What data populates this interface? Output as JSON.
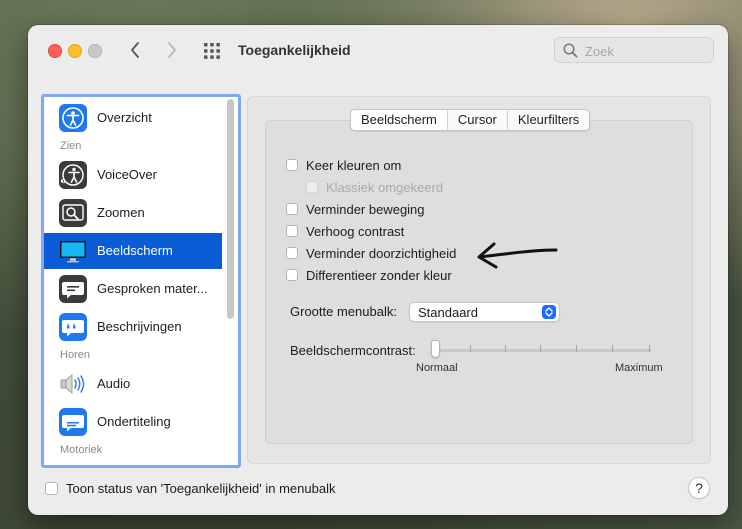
{
  "window": {
    "title": "Toegankelijkheid"
  },
  "search": {
    "placeholder": "Zoek"
  },
  "sidebar": {
    "items": [
      {
        "label": "Overzicht",
        "icon": "accessibility-icon"
      },
      {
        "section": "Zien"
      },
      {
        "label": "VoiceOver",
        "icon": "voiceover-icon"
      },
      {
        "label": "Zoomen",
        "icon": "zoom-icon"
      },
      {
        "label": "Beeldscherm",
        "icon": "display-icon",
        "selected": true
      },
      {
        "label": "Gesproken mater...",
        "icon": "spoken-content-icon"
      },
      {
        "label": "Beschrijvingen",
        "icon": "descriptions-icon"
      },
      {
        "section": "Horen"
      },
      {
        "label": "Audio",
        "icon": "speaker-icon"
      },
      {
        "label": "Ondertiteling",
        "icon": "captions-icon"
      },
      {
        "section": "Motoriek"
      }
    ]
  },
  "tabs": [
    "Beeldscherm",
    "Cursor",
    "Kleurfilters"
  ],
  "options": [
    {
      "label": "Keer kleuren om",
      "checked": false,
      "disabled": false
    },
    {
      "label": "Klassiek omgekeerd",
      "checked": false,
      "disabled": true
    },
    {
      "label": "Verminder beweging",
      "checked": false,
      "disabled": false
    },
    {
      "label": "Verhoog contrast",
      "checked": false,
      "disabled": false
    },
    {
      "label": "Verminder doorzichtigheid",
      "checked": false,
      "disabled": false
    },
    {
      "label": "Differentieer zonder kleur",
      "checked": false,
      "disabled": false
    }
  ],
  "menubar_size": {
    "label": "Grootte menubalk:",
    "value": "Standaard"
  },
  "contrast": {
    "label": "Beeldschermcontrast:",
    "min_label": "Normaal",
    "max_label": "Maximum",
    "value": 0
  },
  "footer": {
    "status_label": "Toon status van 'Toegankelijkheid' in menubalk",
    "help": "?"
  },
  "colors": {
    "accent": "#0a5bd6",
    "sidebar_focus": "#7fa9f0"
  }
}
